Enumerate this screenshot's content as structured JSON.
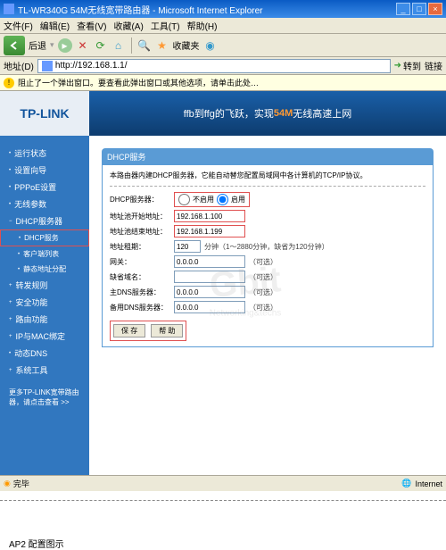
{
  "window": {
    "title": "TL-WR340G 54M无线宽带路由器 - Microsoft Internet Explorer",
    "min": "_",
    "max": "□",
    "close": "×"
  },
  "menu": {
    "file": "文件(F)",
    "edit": "编辑(E)",
    "view": "查看(V)",
    "fav": "收藏(A)",
    "tools": "工具(T)",
    "help": "帮助(H)"
  },
  "toolbar": {
    "back": "后退",
    "fav": "收藏夹"
  },
  "address": {
    "label": "地址(D)",
    "url": "http://192.168.1.1/",
    "go": "转到",
    "links": "链接"
  },
  "infobar": {
    "text": "阻止了一个弹出窗口。要查看此弹出窗口或其他选项，请单击此处…"
  },
  "banner": {
    "brand": "TP-LINK",
    "text1": "ffb到ffg的飞跃，实现",
    "text54": "54M",
    "text2": "无线高速上网"
  },
  "sidebar": {
    "items": [
      {
        "label": "运行状态"
      },
      {
        "label": "设置向导"
      },
      {
        "label": "PPPoE设置"
      },
      {
        "label": "无线参数"
      },
      {
        "label": "DHCP服务器",
        "expanded": true
      },
      {
        "label": "DHCP服务",
        "sub": true,
        "active": true
      },
      {
        "label": "客户端列表",
        "sub": true
      },
      {
        "label": "静态地址分配",
        "sub": true
      },
      {
        "label": "转发规则"
      },
      {
        "label": "安全功能"
      },
      {
        "label": "路由功能"
      },
      {
        "label": "IP与MAC绑定"
      },
      {
        "label": "动态DNS"
      },
      {
        "label": "系统工具"
      }
    ],
    "footer": "更多TP-LINK宽带路由器，请点击查看 >>"
  },
  "panel": {
    "title": "DHCP服务",
    "desc": "本路由器内建DHCP服务器，它能自动替您配置局域网中各计算机的TCP/IP协议。",
    "rows": {
      "server_label": "DHCP服务器：",
      "opt_off": "不启用",
      "opt_on": "启用",
      "start_label": "地址池开始地址：",
      "start_val": "192.168.1.100",
      "end_label": "地址池结束地址：",
      "end_val": "192.168.1.199",
      "lease_label": "地址租期：",
      "lease_val": "120",
      "lease_hint": "分钟（1～2880分钟，缺省为120分钟）",
      "gateway_label": "网关：",
      "gateway_val": "0.0.0.0",
      "opt_hint": "（可选）",
      "domain_label": "缺省域名：",
      "domain_val": "",
      "dns1_label": "主DNS服务器：",
      "dns1_val": "0.0.0.0",
      "dns2_label": "备用DNS服务器：",
      "dns2_val": "0.0.0.0"
    },
    "save": "保 存",
    "help": "帮 助"
  },
  "status": {
    "done": "完毕",
    "zone": "Internet"
  },
  "footer_text": "AP2 配置图示"
}
